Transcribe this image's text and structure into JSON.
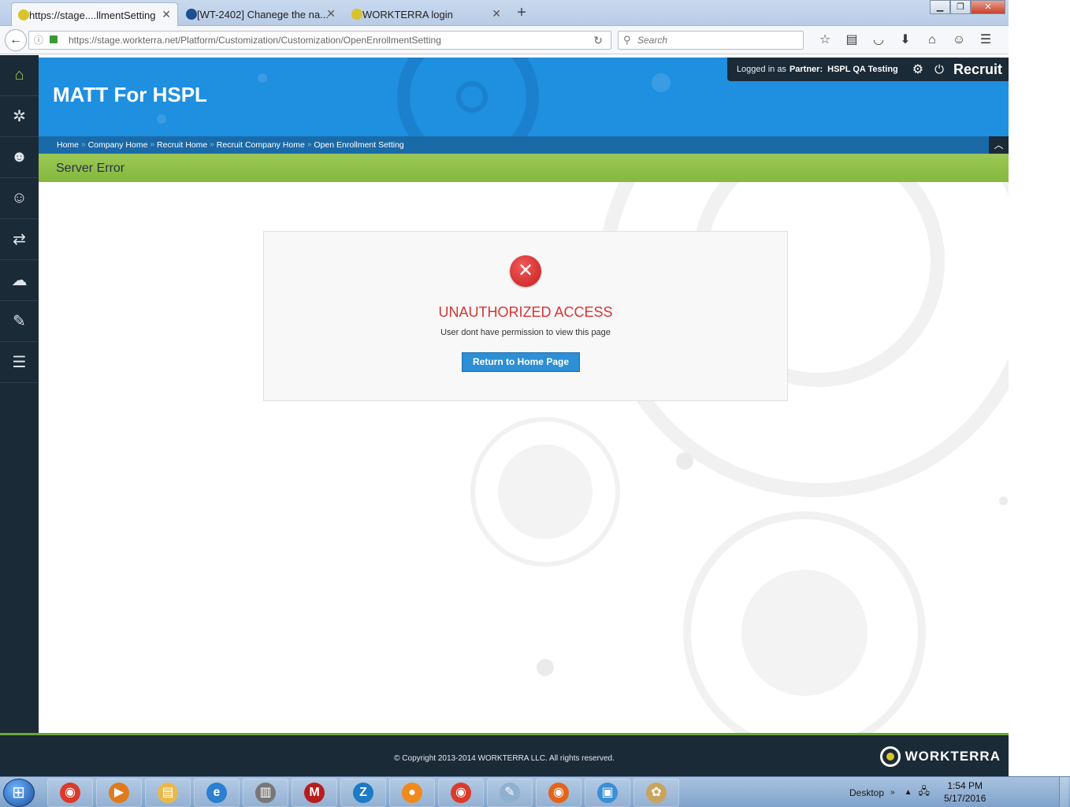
{
  "browser": {
    "tabs": [
      {
        "label": "https://stage....llmentSetting",
        "active": true,
        "favicon_color": "#d8c42a"
      },
      {
        "label": "[WT-2402] Chanege the na...",
        "active": false,
        "favicon_color": "#1d4f91"
      },
      {
        "label": "WORKTERRA login",
        "active": false,
        "favicon_color": "#d8c42a"
      }
    ],
    "tab_close_glyph": "✕",
    "new_tab_glyph": "+",
    "url": "https://stage.workterra.net/Platform/Customization/Customization/OpenEnrollmentSetting",
    "search_placeholder": "Search",
    "window_buttons": {
      "minimize": "▁",
      "restore": "❐",
      "close": "✕"
    }
  },
  "sidebar": {
    "items": [
      {
        "icon": "home-icon",
        "glyph": "⌂"
      },
      {
        "icon": "puzzle-icon",
        "glyph": "✲"
      },
      {
        "icon": "user-star-icon",
        "glyph": "☻"
      },
      {
        "icon": "user-icon",
        "glyph": "☺"
      },
      {
        "icon": "transfer-icon",
        "glyph": "⇄"
      },
      {
        "icon": "chat-icon",
        "glyph": "☁"
      },
      {
        "icon": "briefcase-icon",
        "glyph": "✎"
      },
      {
        "icon": "report-icon",
        "glyph": "☰"
      }
    ]
  },
  "header": {
    "company": "MATT For HSPL",
    "login_prefix": "Logged in as",
    "login_role": "Partner:",
    "login_name": "HSPL QA Testing",
    "module": "Recruit",
    "gear_glyph": "⚙",
    "power_glyph": "⏻"
  },
  "breadcrumb": {
    "items": [
      "Home",
      "Company Home",
      "Recruit Home",
      "Recruit Company Home",
      "Open Enrollment Setting"
    ],
    "separator": "»"
  },
  "page": {
    "title": "Server Error"
  },
  "error": {
    "glyph": "✕",
    "heading": "UNAUTHORIZED ACCESS",
    "message": "User dont have permission to view this page",
    "button_label": "Return to Home Page"
  },
  "footer": {
    "copyright": "© Copyright 2013-2014 WORKTERRA LLC. All rights reserved.",
    "brand": "WORKTERRA"
  },
  "taskbar": {
    "apps": [
      {
        "icon": "chrome-icon",
        "color": "#d93b2b",
        "glyph": "◉"
      },
      {
        "icon": "media-player-icon",
        "color": "#e07a1c",
        "glyph": "▶"
      },
      {
        "icon": "file-explorer-icon",
        "color": "#e8b94a",
        "glyph": "▤"
      },
      {
        "icon": "internet-explorer-icon",
        "color": "#2c7fd0",
        "glyph": "e"
      },
      {
        "icon": "archive-icon",
        "color": "#777777",
        "glyph": "▥"
      },
      {
        "icon": "mcafee-icon",
        "color": "#b81d1d",
        "glyph": "M"
      },
      {
        "icon": "zoom-app-icon",
        "color": "#1b7bc4",
        "glyph": "Z"
      },
      {
        "icon": "flame-app-icon",
        "color": "#f08a1c",
        "glyph": "●"
      },
      {
        "icon": "chrome-icon",
        "color": "#d93b2b",
        "glyph": "◉"
      },
      {
        "icon": "notepad-icon",
        "color": "#8fb0cf",
        "glyph": "✎"
      },
      {
        "icon": "firefox-icon",
        "color": "#e4641c",
        "glyph": "◉"
      },
      {
        "icon": "photo-viewer-icon",
        "color": "#3a8fd6",
        "glyph": "▣"
      },
      {
        "icon": "paint-icon",
        "color": "#c8a45c",
        "glyph": "✿"
      }
    ],
    "desktop_label": "Desktop",
    "time": "1:54 PM",
    "date": "5/17/2016"
  }
}
